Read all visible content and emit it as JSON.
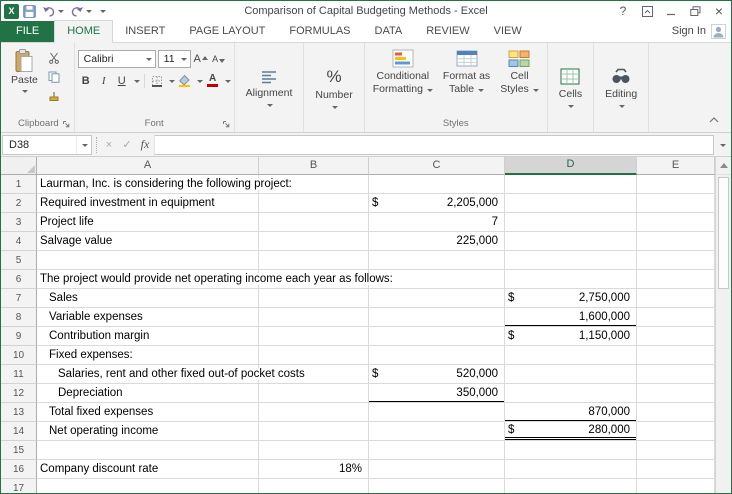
{
  "window": {
    "title": "Comparison of Capital Budgeting Methods - Excel",
    "sign_in": "Sign In"
  },
  "icons": {
    "app_letter": "X",
    "help": "?",
    "close": "×",
    "cancel": "×",
    "check": "✓"
  },
  "tabs": [
    {
      "label": "FILE"
    },
    {
      "label": "HOME"
    },
    {
      "label": "INSERT"
    },
    {
      "label": "PAGE LAYOUT"
    },
    {
      "label": "FORMULAS"
    },
    {
      "label": "DATA"
    },
    {
      "label": "REVIEW"
    },
    {
      "label": "VIEW"
    }
  ],
  "ribbon": {
    "paste_label": "Paste",
    "clipboard_label": "Clipboard",
    "font_label": "Font",
    "font_family": "Calibri",
    "font_size": "11",
    "letter_a": "A",
    "bold": "B",
    "italic": "I",
    "underline": "U",
    "percent": "%",
    "alignment_label": "Alignment",
    "number_label": "Number",
    "styles_label": "Styles",
    "conditional_line1": "Conditional",
    "conditional_line2": "Formatting",
    "format_table_line1": "Format as",
    "format_table_line2": "Table",
    "cell_styles_line1": "Cell",
    "cell_styles_line2": "Styles",
    "cells_label": "Cells",
    "editing_label": "Editing"
  },
  "formula_bar": {
    "name_box": "D38",
    "fx": "fx",
    "value": ""
  },
  "sheet": {
    "selected_column": "D",
    "columns": [
      "A",
      "B",
      "C",
      "D",
      "E"
    ],
    "col_widths": {
      "A": 222,
      "B": 110,
      "C": 136,
      "D": 132,
      "E": 0
    },
    "rows": [
      {
        "n": "1",
        "cells": [
          {
            "col": "A",
            "text": "Laurman, Inc. is considering the following project:",
            "overflow": true
          }
        ]
      },
      {
        "n": "2",
        "cells": [
          {
            "col": "A",
            "text": "Required investment in equipment"
          },
          {
            "col": "C",
            "prefix": "$",
            "text": "2,205,000"
          }
        ]
      },
      {
        "n": "3",
        "cells": [
          {
            "col": "A",
            "text": "Project life"
          },
          {
            "col": "C",
            "text": "7",
            "align": "right"
          }
        ]
      },
      {
        "n": "4",
        "cells": [
          {
            "col": "A",
            "text": "Salvage value"
          },
          {
            "col": "C",
            "text": "225,000",
            "align": "right"
          }
        ]
      },
      {
        "n": "5",
        "cells": []
      },
      {
        "n": "6",
        "cells": [
          {
            "col": "A",
            "text": "The project would provide net operating income each year as follows:",
            "overflow": true
          }
        ]
      },
      {
        "n": "7",
        "cells": [
          {
            "col": "A",
            "text": "Sales",
            "indent": 1
          },
          {
            "col": "D",
            "prefix": "$",
            "text": "2,750,000"
          }
        ]
      },
      {
        "n": "8",
        "cells": [
          {
            "col": "A",
            "text": "Variable expenses",
            "indent": 1
          },
          {
            "col": "D",
            "text": "1,600,000",
            "align": "right",
            "border": "single"
          }
        ]
      },
      {
        "n": "9",
        "cells": [
          {
            "col": "A",
            "text": "Contribution margin",
            "indent": 1
          },
          {
            "col": "D",
            "prefix": "$",
            "text": "1,150,000"
          }
        ]
      },
      {
        "n": "10",
        "cells": [
          {
            "col": "A",
            "text": "Fixed expenses:",
            "indent": 1
          }
        ]
      },
      {
        "n": "11",
        "cells": [
          {
            "col": "A",
            "text": "Salaries, rent and other fixed out-of pocket costs",
            "indent": 2,
            "overflow": true
          },
          {
            "col": "C",
            "prefix": "$",
            "text": "520,000"
          }
        ]
      },
      {
        "n": "12",
        "cells": [
          {
            "col": "A",
            "text": "Depreciation",
            "indent": 2
          },
          {
            "col": "C",
            "text": "350,000",
            "align": "right",
            "border": "single"
          }
        ]
      },
      {
        "n": "13",
        "cells": [
          {
            "col": "A",
            "text": "Total fixed expenses",
            "indent": 1
          },
          {
            "col": "D",
            "text": "870,000",
            "align": "right",
            "border": "single"
          }
        ]
      },
      {
        "n": "14",
        "cells": [
          {
            "col": "A",
            "text": "Net operating income",
            "indent": 1
          },
          {
            "col": "D",
            "prefix": "$",
            "text": "280,000",
            "border": "double"
          }
        ]
      },
      {
        "n": "15",
        "cells": []
      },
      {
        "n": "16",
        "cells": [
          {
            "col": "A",
            "text": "Company discount rate"
          },
          {
            "col": "B",
            "text": "18%",
            "align": "right"
          }
        ]
      },
      {
        "n": "17",
        "cells": []
      }
    ]
  },
  "colors": {
    "excel_green": "#217346"
  }
}
